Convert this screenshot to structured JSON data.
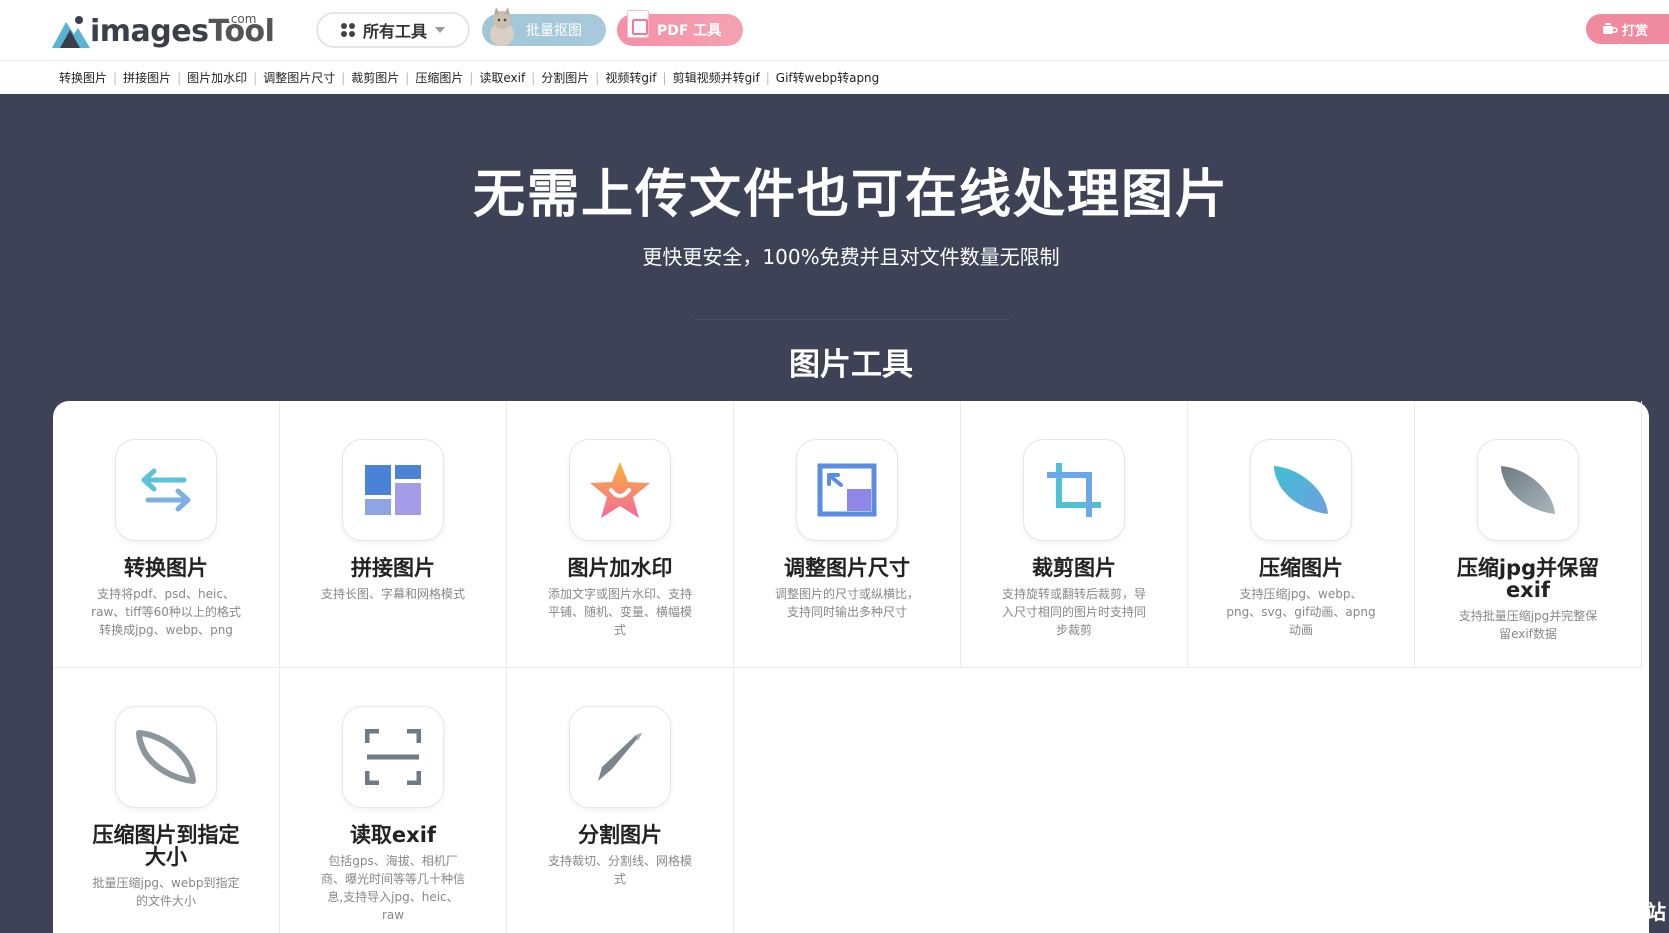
{
  "header": {
    "logo": {
      "text": "images",
      "text2": "Tool",
      "com": ".com"
    },
    "all_tools_label": "所有工具",
    "batch_label": "批量抠图",
    "pdf_label": "PDF 工具",
    "donate_label": "打赏"
  },
  "subnav": [
    "转换图片",
    "拼接图片",
    "图片加水印",
    "调整图片尺寸",
    "裁剪图片",
    "压缩图片",
    "读取exif",
    "分割图片",
    "视频转gif",
    "剪辑视频并转gif",
    "Gif转webp转apng"
  ],
  "hero": {
    "title": "无需上传文件也可在线处理图片",
    "subtitle": "更快更安全，100%免费并且对文件数量无限制"
  },
  "section_title": "图片工具",
  "tools": [
    {
      "name": "转换图片",
      "desc": "支持将pdf、psd、heic、raw、tiff等60种以上的格式转换成jpg、webp、png",
      "icon": "convert-arrows-icon"
    },
    {
      "name": "拼接图片",
      "desc": "支持长图、字幕和网格模式",
      "icon": "collage-icon"
    },
    {
      "name": "图片加水印",
      "desc": "添加文字或图片水印、支持平铺、随机、变量、横幅模式",
      "icon": "star-watermark-icon"
    },
    {
      "name": "调整图片尺寸",
      "desc": "调整图片的尺寸或纵横比，支持同时输出多种尺寸",
      "icon": "resize-icon"
    },
    {
      "name": "裁剪图片",
      "desc": "支持旋转或翻转后裁剪，导入尺寸相同的图片时支持同步裁剪",
      "icon": "crop-icon"
    },
    {
      "name": "压缩图片",
      "desc": "支持压缩jpg、webp、png、svg、gif动画、apng动画",
      "icon": "leaf-icon"
    },
    {
      "name": "压缩jpg并保留exif",
      "desc": "支持批量压缩jpg并完整保留exif数据",
      "icon": "leaf-gray-icon"
    },
    {
      "name": "压缩图片到指定大小",
      "desc": "批量压缩jpg、webp到指定的文件大小",
      "icon": "leaf-outline-icon"
    },
    {
      "name": "读取exif",
      "desc": "包括gps、海拔、相机厂商、曝光时间等等几十种信息,支持导入jpg、heic、raw",
      "icon": "scan-icon"
    },
    {
      "name": "分割图片",
      "desc": "支持裁切、分割线、网格模式",
      "icon": "knife-icon"
    }
  ],
  "corner_char": "站",
  "colors": {
    "hero_bg": "#3e4257",
    "batch_pill": "#a3c8da",
    "pdf_pill": "#f591a7",
    "donate_pill": "#f08a9e"
  }
}
